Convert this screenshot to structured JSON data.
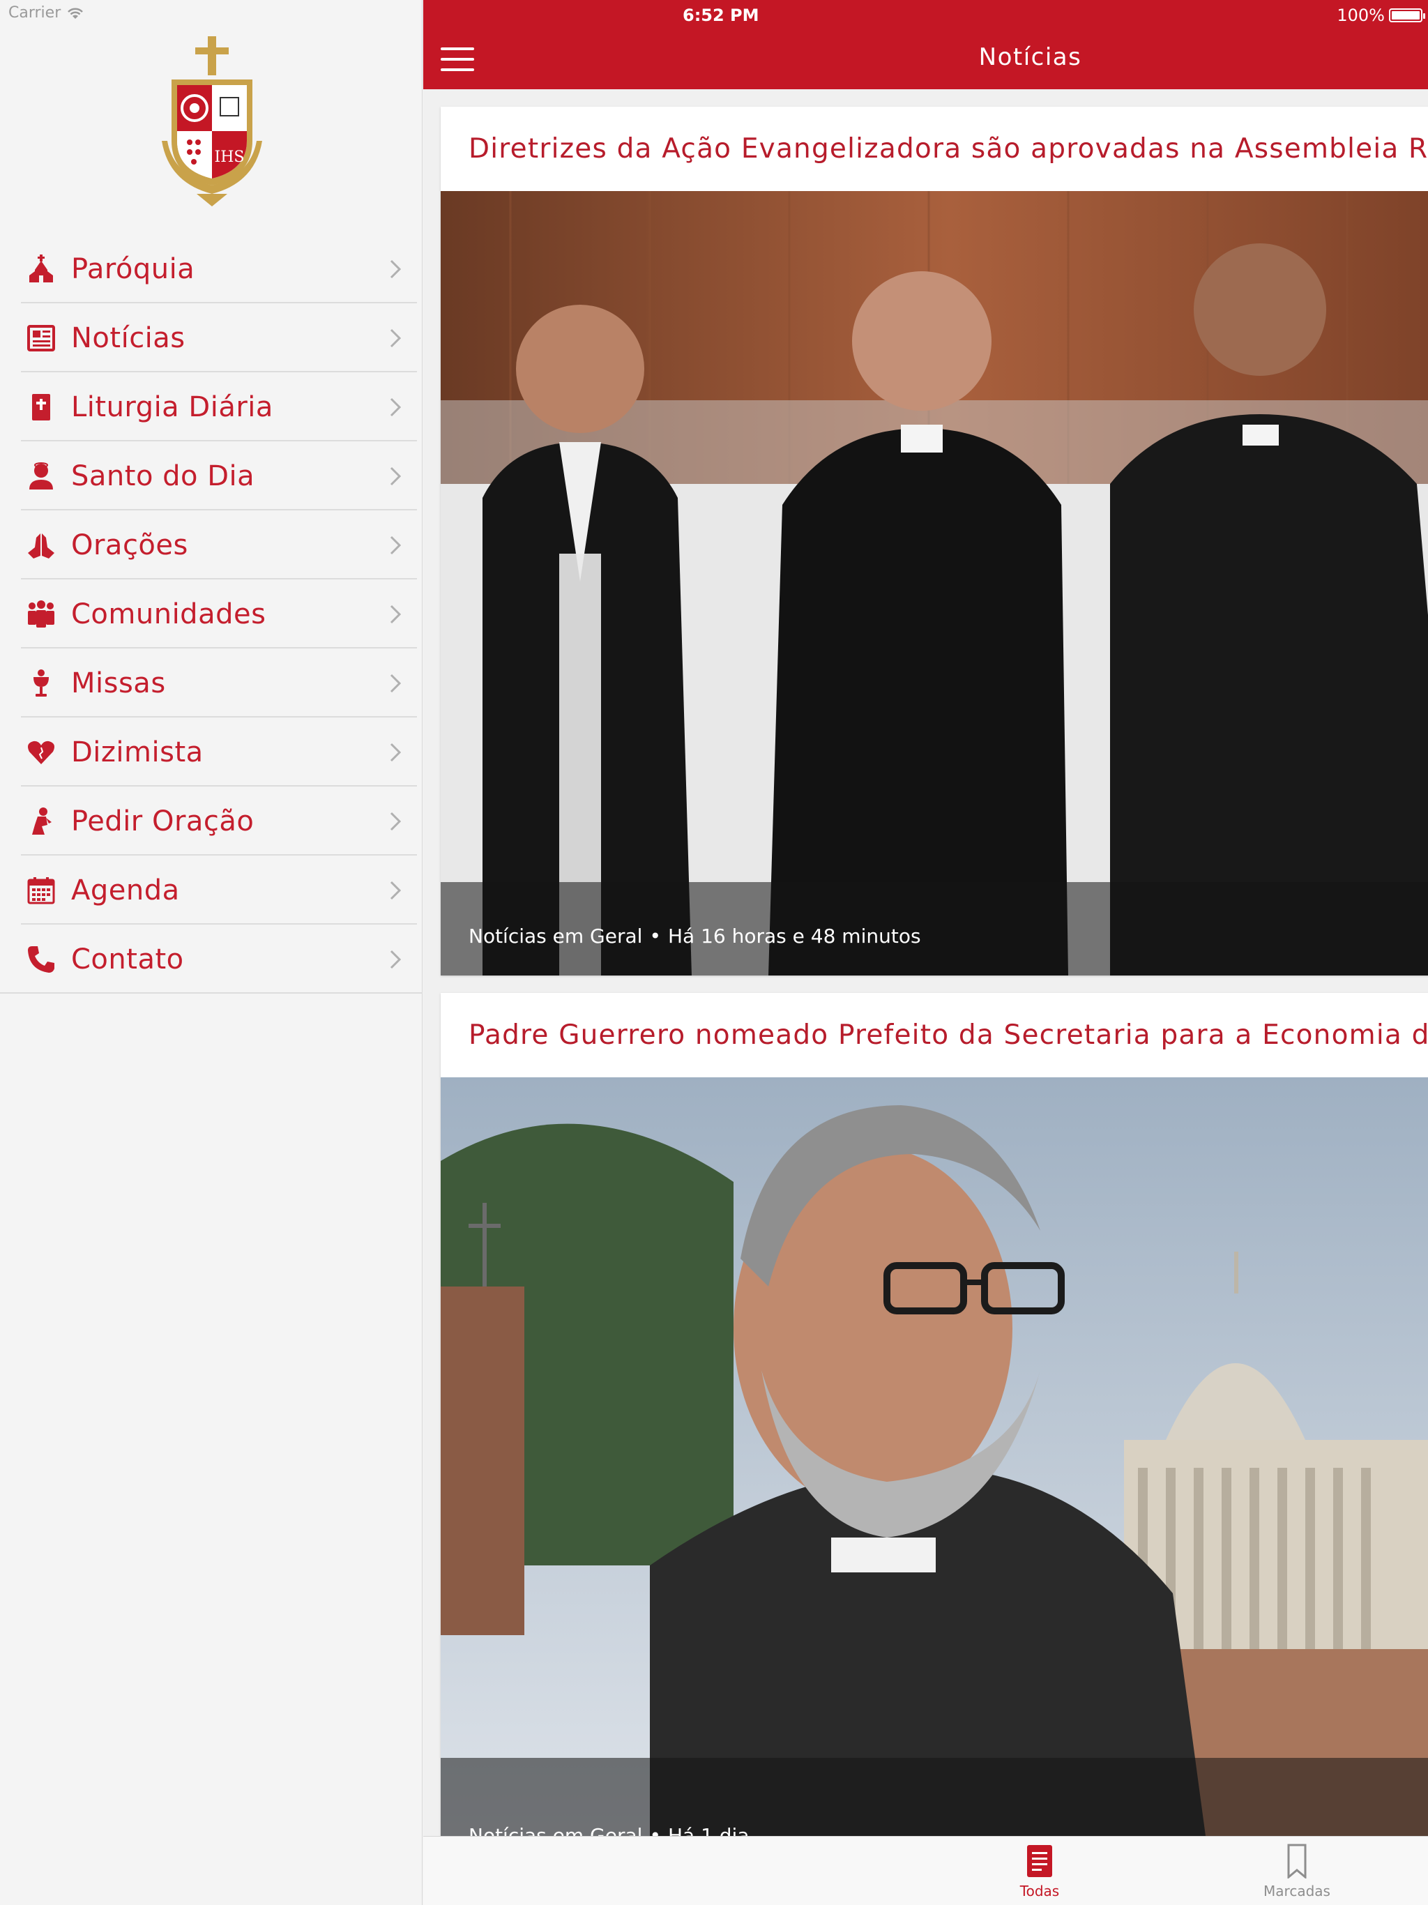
{
  "status_bar": {
    "carrier": "Carrier",
    "time": "6:52 PM",
    "battery": "100%"
  },
  "colors": {
    "accent": "#c41725",
    "menu_text": "#c41e2d",
    "card_title": "#b71c2b"
  },
  "sidebar": {
    "items": [
      {
        "label": "Paróquia",
        "icon": "church-icon"
      },
      {
        "label": "Notícias",
        "icon": "newspaper-icon"
      },
      {
        "label": "Liturgia Diária",
        "icon": "bible-icon"
      },
      {
        "label": "Santo do Dia",
        "icon": "saint-icon"
      },
      {
        "label": "Orações",
        "icon": "praying-hands-icon"
      },
      {
        "label": "Comunidades",
        "icon": "community-icon"
      },
      {
        "label": "Missas",
        "icon": "chalice-icon"
      },
      {
        "label": "Dizimista",
        "icon": "heart-icon"
      },
      {
        "label": "Pedir Oração",
        "icon": "kneeling-person-icon"
      },
      {
        "label": "Agenda",
        "icon": "calendar-icon"
      },
      {
        "label": "Contato",
        "icon": "phone-icon"
      }
    ]
  },
  "header": {
    "title": "Notícias"
  },
  "articles": [
    {
      "title": "Diretrizes da Ação Evangelizadora são aprovadas na Assembleia R",
      "category": "Notícias em Geral",
      "time": "Há 16 horas e 48 minutos"
    },
    {
      "title": "Padre Guerrero nomeado Prefeito da Secretaria para a Economia d",
      "category": "Notícias em Geral",
      "time": "Há 1 dia"
    }
  ],
  "tabbar": {
    "todas": "Todas",
    "marcadas": "Marcadas"
  },
  "separator": "•"
}
